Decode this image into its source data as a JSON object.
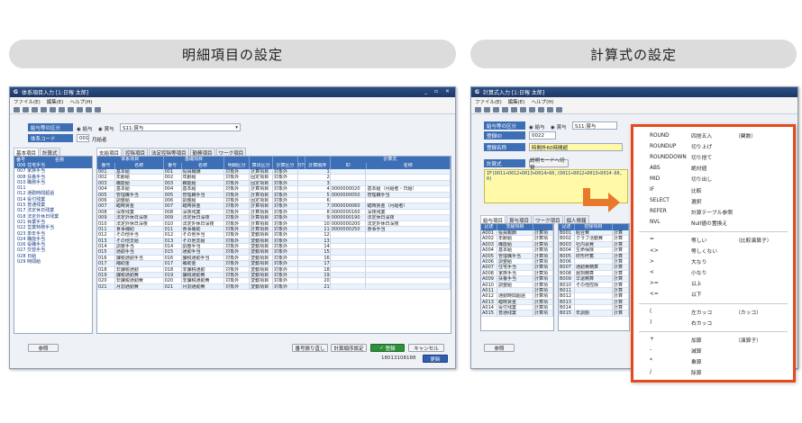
{
  "sections": {
    "left_title": "明細項目の設定",
    "right_title": "計算式の設定"
  },
  "left_window": {
    "title": "体系項目入力 [1:日報 太郎]",
    "menu": [
      "ファイル(E)",
      "編集(E)",
      "ヘルプ(H)"
    ],
    "fields": {
      "system_label": "給与等の区分",
      "radio_salary": "給与",
      "radio_bonus": "賞与",
      "system_value": "S11:賞与",
      "code_label": "体系コード",
      "code_value": "001",
      "code_name": "月給者"
    },
    "left_tabs": [
      "基本項目",
      "計算式"
    ],
    "left_list": {
      "headers": [
        "番号",
        "名称"
      ],
      "rows": [
        "006 住宅手当",
        "007 家族手当",
        "008 扶養手当",
        "010 職務手当",
        "011 ",
        "012 通勤時間超過",
        "014 役付残業",
        "015 普通残業",
        "017 法定休日残業",
        "018 法定外休日残業",
        "021 休業手当",
        "022 営業特務手当",
        "023 単年手当",
        "024 職能手当",
        "026 役職手当",
        "027 交替手当",
        "028 日給",
        "029 時間給"
      ]
    },
    "grid_tabs": [
      "支給項目",
      "控除項目",
      "法定控除等項目",
      "勤務項目",
      "ワーク項目"
    ],
    "grid_group_headers": [
      "体系項目",
      "基礎項目",
      "",
      "",
      "",
      "",
      "",
      "計算式"
    ],
    "grid_headers": [
      "番号",
      "名称",
      "番号",
      "名称",
      "明細区分",
      "算出区分",
      "計算区分",
      "印字区分",
      "計算順序",
      "ID",
      "名称"
    ],
    "grid_rows": [
      [
        "001",
        "基本給",
        "001",
        "役員報酬",
        "対象外",
        "計算項目",
        "対象外",
        "1",
        "",
        ""
      ],
      [
        "002",
        "年齢給",
        "002",
        "年齢給",
        "対象外",
        "固定項目",
        "対象外",
        "2",
        "",
        ""
      ],
      [
        "003",
        "職能給",
        "003",
        "職能給",
        "対象外",
        "固定項目",
        "対象外",
        "3",
        "",
        ""
      ],
      [
        "004",
        "基本給",
        "004",
        "基本給",
        "対象外",
        "計算項目",
        "対象外",
        "4",
        "0000000020",
        "基本給（月給者・日給）"
      ],
      [
        "005",
        "管理職手当",
        "005",
        "管理職手当",
        "対象外",
        "計算項目",
        "対象外",
        "5",
        "0000000050",
        "管理職手当"
      ],
      [
        "006",
        "調整給",
        "006",
        "調整給",
        "対象外",
        "固定項目",
        "対象外",
        "6",
        "",
        ""
      ],
      [
        "007",
        "臨時賃金",
        "007",
        "臨時賃金",
        "対象外",
        "計算項目",
        "対象外",
        "7",
        "0000000060",
        "臨時賃金（月給者）"
      ],
      [
        "008",
        "深夜残業",
        "008",
        "深夜残業",
        "対象外",
        "計算項目",
        "対象外",
        "8",
        "0000000160",
        "深夜残業"
      ],
      [
        "009",
        "法定外休日深夜",
        "009",
        "法定休日深夜",
        "対象外",
        "計算項目",
        "対象外",
        "9",
        "0000000190",
        "法定休日深夜"
      ],
      [
        "010",
        "法定外休日深夜",
        "010",
        "法定外休日深夜",
        "対象外",
        "計算項目",
        "対象外",
        "10",
        "0000000200",
        "法定外休日深夜"
      ],
      [
        "011",
        "食事補助",
        "011",
        "食事補助",
        "対象外",
        "計算項目",
        "対象外",
        "11",
        "0000000250",
        "食事手当"
      ],
      [
        "012",
        "その他手当",
        "012",
        "その他手当",
        "対象外",
        "変動項目",
        "対象外",
        "12",
        "",
        ""
      ],
      [
        "013",
        "その他支給",
        "013",
        "その他支給",
        "対象外",
        "変動項目",
        "対象外",
        "13",
        "",
        ""
      ],
      [
        "014",
        "調整手当",
        "014",
        "調整手当",
        "対象外",
        "変動項目",
        "対象外",
        "14",
        "",
        ""
      ],
      [
        "015",
        "通勤手当",
        "015",
        "通勤手当",
        "対象外",
        "変動項目",
        "対象外",
        "15",
        "",
        ""
      ],
      [
        "016",
        "課税通勤手当",
        "016",
        "課税通勤手当",
        "対象外",
        "変動項目",
        "対象外",
        "16",
        "",
        ""
      ],
      [
        "017",
        "補助金",
        "017",
        "補助金",
        "対象外",
        "変動項目",
        "対象外",
        "17",
        "",
        ""
      ],
      [
        "018",
        "非課税通勤",
        "018",
        "非課税通勤",
        "対象外",
        "変動項目",
        "対象外",
        "18",
        "",
        ""
      ],
      [
        "019",
        "課税通勤費",
        "019",
        "課税通勤費",
        "対象外",
        "変動項目",
        "対象外",
        "19",
        "",
        ""
      ],
      [
        "020",
        "非課税通勤費",
        "020",
        "非課税通勤費",
        "対象外",
        "変動項目",
        "対象外",
        "20",
        "",
        ""
      ],
      [
        "021",
        "月割通勤費",
        "021",
        "月割通勤費",
        "対象外",
        "変動項目",
        "対象外",
        "21",
        "",
        ""
      ]
    ],
    "buttons": {
      "reference": "参照",
      "renumber": "番号振り直し",
      "calc_order": "計算順序設定",
      "register": "登録",
      "cancel": "キャンセル",
      "update": "更新"
    },
    "status_number": "18013108188"
  },
  "right_window": {
    "title": "計算式入力 [1:日報 太郎]",
    "menu": [
      "ファイル(E)",
      "編集(E)",
      "ヘルプ(H)"
    ],
    "fields": {
      "system_label": "給与等の区分",
      "radio_salary": "給与",
      "radio_bonus": "賞与",
      "system_value": "S11:賞与",
      "code_label": "登録ID",
      "code_value": "0022",
      "name_label": "登録名称",
      "name_value": "時間外60時間超",
      "formula_label": "計算式",
      "mode_button": "説明モードへ切替"
    },
    "formula": "IF(D011+D012+D013+D014>60,(D011+D012+D013+D014-60,0)",
    "lower_tabs": [
      "給与項目",
      "賞与項目",
      "ワーク項目",
      "個人情報"
    ],
    "list_a": {
      "headers": [
        "記述",
        "支給項目",
        ""
      ],
      "rows": [
        [
          "A001",
          "役員報酬",
          "計算項"
        ],
        [
          "A002",
          "年齢給",
          "計算項"
        ],
        [
          "A003",
          "職能給",
          "計算項"
        ],
        [
          "A004",
          "基本給",
          "計算項"
        ],
        [
          "A005",
          "管理職手当",
          "計算項"
        ],
        [
          "A006",
          "調整給",
          "計算項"
        ],
        [
          "A007",
          "住宅手当",
          "計算項"
        ],
        [
          "A008",
          "家族手当",
          "計算項"
        ],
        [
          "A009",
          "扶養手当",
          "計算項"
        ],
        [
          "A010",
          "調整給",
          "計算項"
        ],
        [
          "A011",
          "",
          "計算項"
        ],
        [
          "A012",
          "通勤時間超過",
          "計算項"
        ],
        [
          "A013",
          "臨時賃金",
          "計算項"
        ],
        [
          "A014",
          "役付残業",
          "計算項"
        ],
        [
          "A015",
          "普通残業",
          "計算項"
        ]
      ]
    },
    "list_b": {
      "headers": [
        "記述",
        "控除項目",
        ""
      ],
      "rows": [
        [
          "B001",
          "組合費",
          "計算"
        ],
        [
          "B002",
          "クラブ活動費",
          "計算"
        ],
        [
          "B003",
          "社内会費",
          "計算"
        ],
        [
          "B004",
          "生命保険",
          "計算"
        ],
        [
          "B005",
          "財形貯蓄",
          "計算"
        ],
        [
          "B006",
          "",
          "計算"
        ],
        [
          "B007",
          "通勤費精算",
          "計算"
        ],
        [
          "B008",
          "遅刻精算",
          "計算"
        ],
        [
          "B009",
          "早退精算",
          "計算"
        ],
        [
          "B010",
          "その他控除",
          "計算"
        ],
        [
          "B011",
          "",
          "計算"
        ],
        [
          "B012",
          "",
          "計算"
        ],
        [
          "B013",
          "",
          "計算"
        ],
        [
          "B014",
          "",
          "計算"
        ],
        [
          "B015",
          "年調額",
          "計算"
        ]
      ]
    },
    "buttons": {
      "reference": "参照"
    }
  },
  "function_popup": {
    "functions": [
      {
        "key": "ROUND",
        "desc": "四捨五入",
        "note": "（関数）"
      },
      {
        "key": "ROUNDUP",
        "desc": "切り上げ",
        "note": ""
      },
      {
        "key": "ROUNDDOWN",
        "desc": "切り捨て",
        "note": ""
      },
      {
        "key": "ABS",
        "desc": "絶対値",
        "note": ""
      },
      {
        "key": "MID",
        "desc": "切り出し",
        "note": ""
      },
      {
        "key": "IF",
        "desc": "比較",
        "note": ""
      },
      {
        "key": "SELECT",
        "desc": "選択",
        "note": ""
      },
      {
        "key": "REFER",
        "desc": "計算テーブル参照",
        "note": ""
      },
      {
        "key": "NVL",
        "desc": "Null値の置換え",
        "note": ""
      }
    ],
    "comparison": [
      {
        "key": "=",
        "desc": "等しい",
        "note": "（比較演算子）"
      },
      {
        "key": "<>",
        "desc": "等しくない",
        "note": ""
      },
      {
        "key": ">",
        "desc": "大なり",
        "note": ""
      },
      {
        "key": "<",
        "desc": "小なり",
        "note": ""
      },
      {
        "key": ">=",
        "desc": "以上",
        "note": ""
      },
      {
        "key": "<=",
        "desc": "以下",
        "note": ""
      }
    ],
    "parens": [
      {
        "key": "(",
        "desc": "左カッコ",
        "note": "（カッコ）"
      },
      {
        "key": ")",
        "desc": "右カッコ",
        "note": ""
      }
    ],
    "arithmetic": [
      {
        "key": "+",
        "desc": "加算",
        "note": "（演算子）"
      },
      {
        "key": "-",
        "desc": "減算",
        "note": ""
      },
      {
        "key": "*",
        "desc": "乗算",
        "note": ""
      },
      {
        "key": "/",
        "desc": "除算",
        "note": ""
      }
    ]
  },
  "colors": {
    "accent_blue": "#3d6fb6",
    "popup_border": "#e44a1e",
    "formula_bg": "#fff9a8",
    "arrow": "#e8792a"
  }
}
